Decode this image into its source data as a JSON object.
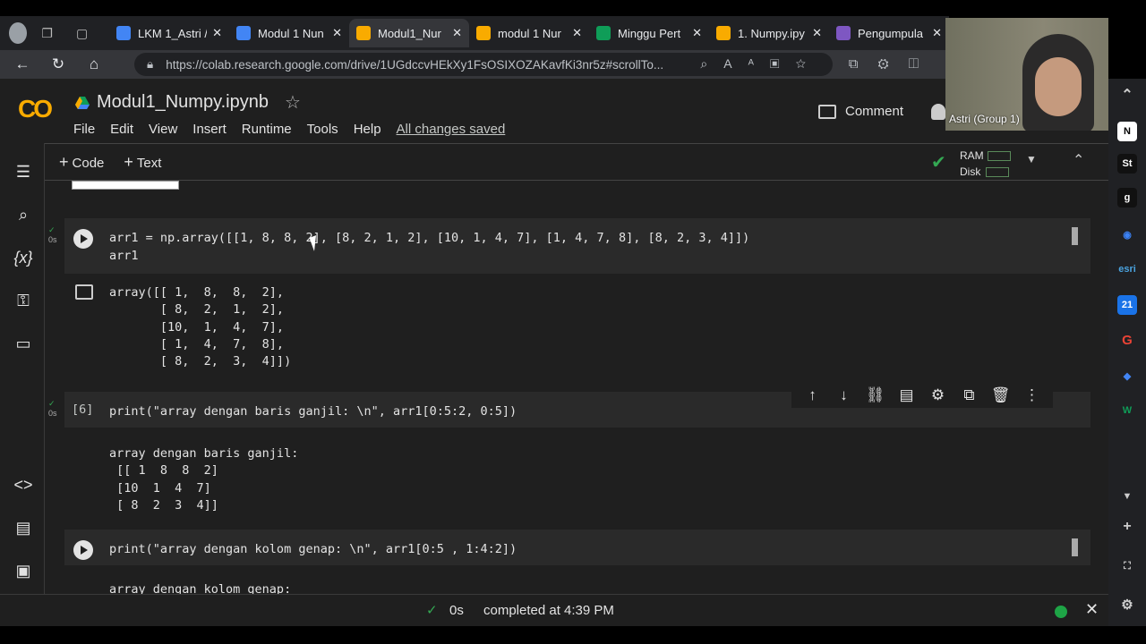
{
  "browser": {
    "tabs": [
      {
        "label": "LKM 1_Astri /",
        "icon": "docs-icon",
        "color": "#4285f4"
      },
      {
        "label": "Modul 1 Nun",
        "icon": "docs-icon",
        "color": "#4285f4"
      },
      {
        "label": "Modul1_Nur",
        "icon": "colab-icon",
        "color": "#f9ab00",
        "active": true
      },
      {
        "label": "modul 1 Nur",
        "icon": "colab-icon",
        "color": "#f9ab00"
      },
      {
        "label": "Minggu Pert",
        "icon": "drive-icon",
        "color": "#0f9d58"
      },
      {
        "label": "1. Numpy.ipy",
        "icon": "colab-icon",
        "color": "#f9ab00"
      },
      {
        "label": "Pengumpula",
        "icon": "forms-icon",
        "color": "#7e57c2"
      }
    ],
    "url": "https://colab.research.google.com/drive/1UGdccvHEkXy1FsOSIXOZAKavfKi3nr5z#scrollTo..."
  },
  "notebook": {
    "title": "Modul1_Numpy.ipynb",
    "menu": [
      "File",
      "Edit",
      "View",
      "Insert",
      "Runtime",
      "Tools",
      "Help"
    ],
    "saved": "All changes saved",
    "comment": "Comment",
    "add_code": "Code",
    "add_text": "Text",
    "ram": "RAM",
    "disk": "Disk"
  },
  "cells": [
    {
      "exec_time": "0s",
      "code": "arr1 = np.array([[1, 8, 8, 2], [8, 2, 1, 2], [10, 1, 4, 7], [1, 4, 7, 8], [8, 2, 3, 4]])\narr1",
      "output": "array([[ 1,  8,  8,  2],\n       [ 8,  2,  1,  2],\n       [10,  1,  4,  7],\n       [ 1,  4,  7,  8],\n       [ 8,  2,  3,  4]])"
    },
    {
      "exec_num": "[6]",
      "exec_time": "0s",
      "code": "print(\"array dengan baris ganjil: \\n\", arr1[0:5:2, 0:5])",
      "output": "array dengan baris ganjil: \n [[ 1  8  8  2]\n [10  1  4  7]\n [ 8  2  3  4]]"
    },
    {
      "code": "print(\"array dengan kolom genap: \\n\", arr1[0:5 , 1:4:2])",
      "output": "array dengan kolom genap:"
    }
  ],
  "status": {
    "time": "0s",
    "message": "completed at 4:39 PM"
  },
  "webcam": {
    "name": "Astri (Group 1)"
  },
  "sidebar_icons": [
    "notion-icon",
    "startup-icon",
    "grammarly-icon",
    "bot-icon",
    "esri-icon",
    "calendar-icon",
    "google-icon",
    "extension-icon",
    "wps-icon"
  ]
}
